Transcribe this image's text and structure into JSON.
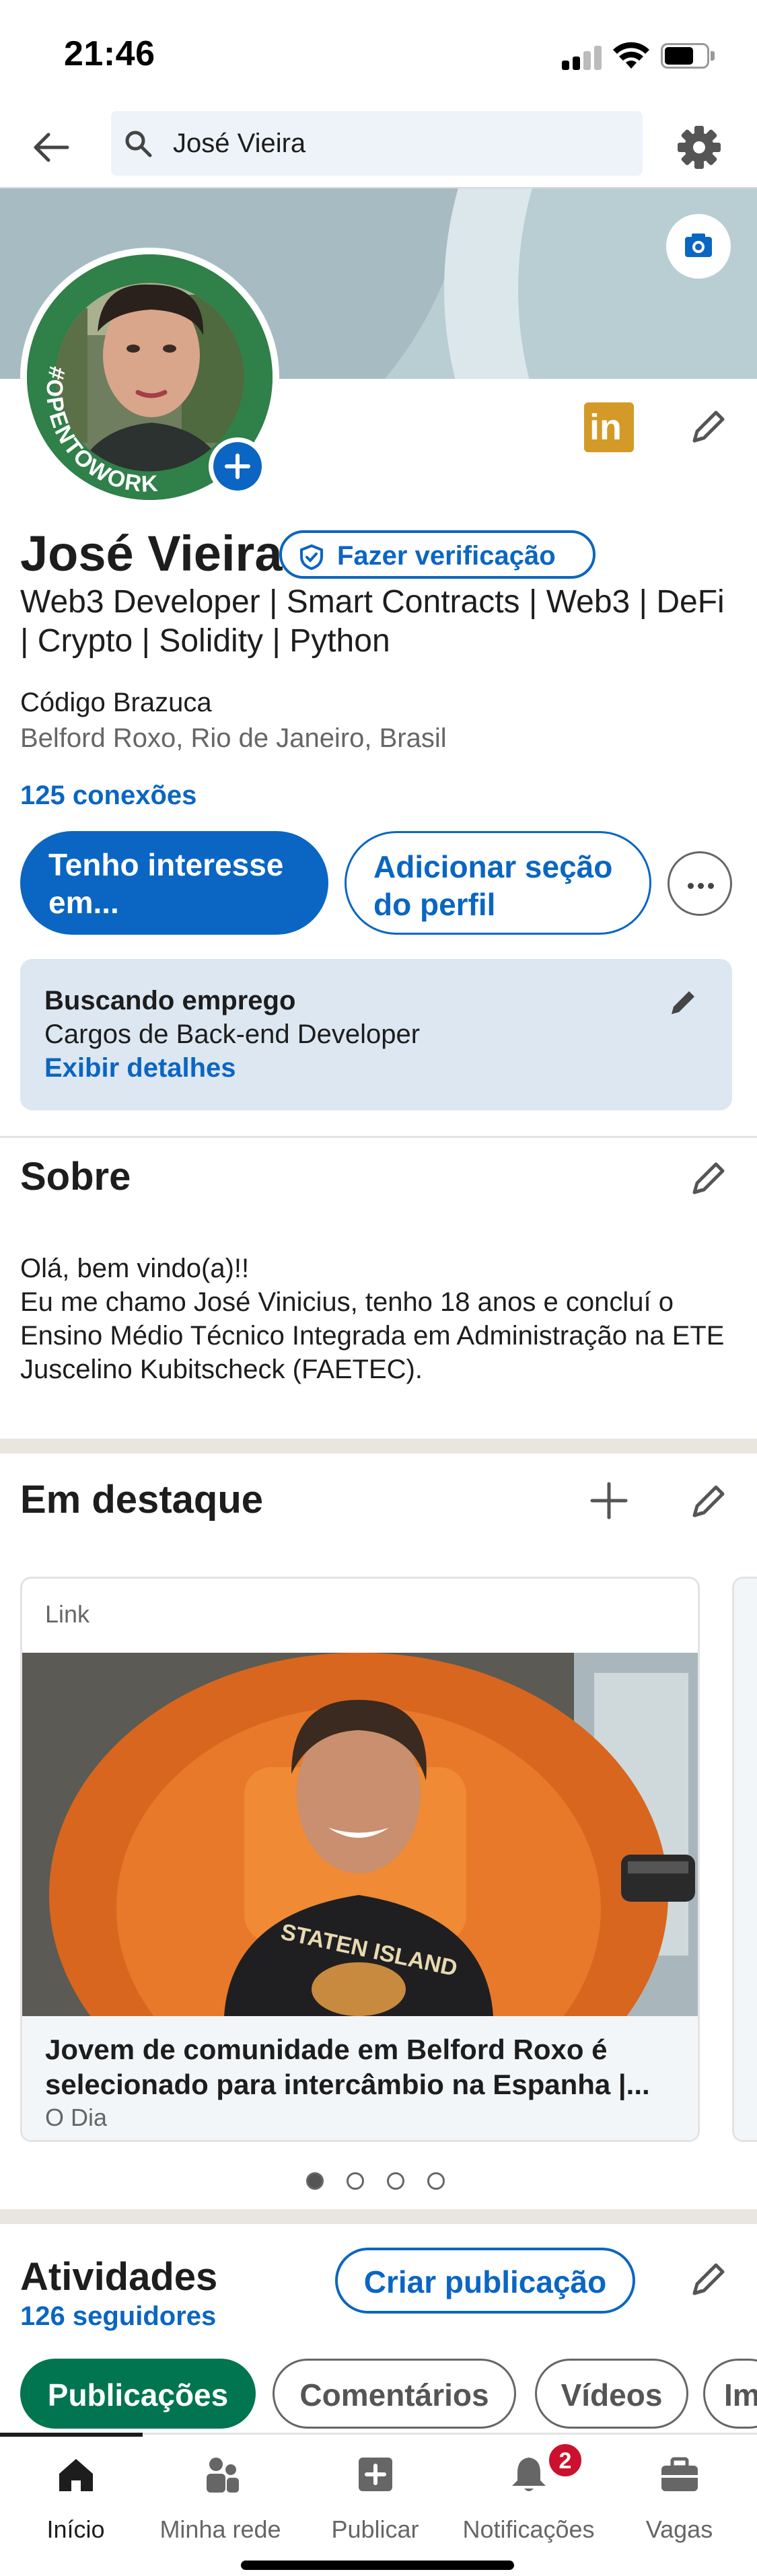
{
  "status_bar": {
    "time": "21:46"
  },
  "header": {
    "search_value": "José Vieira"
  },
  "profile": {
    "name": "José Vieira",
    "verify_label": "Fazer verificação",
    "open_to_work_frame": "#OPENTOWORK",
    "linkedin_badge": "in",
    "headline": "Web3 Developer | Smart Contracts | Web3 | DeFi | Crypto | Solidity | Python",
    "company": "Código Brazuca",
    "location": "Belford Roxo, Rio de Janeiro, Brasil",
    "connections": "125 conexões",
    "primary_button": "Tenho interesse em...",
    "secondary_button": "Adicionar seção do perfil"
  },
  "open_to_work": {
    "title": "Buscando emprego",
    "subtitle": "Cargos de Back-end Developer",
    "details_link": "Exibir detalhes"
  },
  "about": {
    "title": "Sobre",
    "text_line1": "Olá, bem vindo(a)!!",
    "text_line2": "Eu me chamo José Vinicius, tenho 18 anos e concluí o Ensino Médio Técnico Integrada em Administração na ETE Juscelino Kubitscheck (FAETEC)."
  },
  "featured": {
    "title": "Em destaque",
    "card": {
      "kind": "Link",
      "headline": "Jovem de comunidade em Belford Roxo é selecionado para intercâmbio na Espanha |...",
      "source": "O Dia",
      "shirt_text": "STATEN ISLAND"
    },
    "pagination": {
      "total": 4,
      "active": 1
    }
  },
  "activity": {
    "title": "Atividades",
    "followers": "126 seguidores",
    "create_post": "Criar publicação",
    "chips": [
      "Publicações",
      "Comentários",
      "Vídeos",
      "Im"
    ]
  },
  "tabbar": {
    "items": [
      {
        "label": "Início",
        "icon": "home-icon"
      },
      {
        "label": "Minha rede",
        "icon": "network-icon"
      },
      {
        "label": "Publicar",
        "icon": "post-icon"
      },
      {
        "label": "Notificações",
        "icon": "bell-icon"
      },
      {
        "label": "Vagas",
        "icon": "briefcase-icon"
      }
    ],
    "notifications_badge": "2"
  },
  "colors": {
    "brand_blue": "#0a66c2",
    "open_to_work_green": "#2f8049",
    "active_chip": "#01754f",
    "notification_red": "#cb112d"
  }
}
